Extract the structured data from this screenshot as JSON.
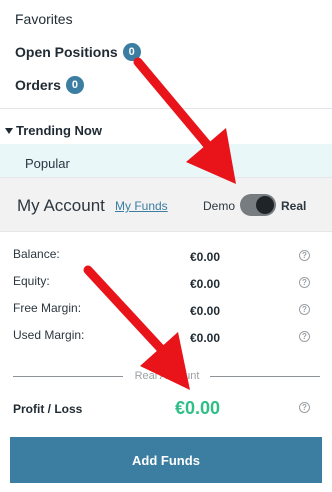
{
  "nav": {
    "items": [
      {
        "label": "Favorites",
        "badge": ""
      },
      {
        "label": "Open Positions",
        "badge": "0"
      },
      {
        "label": "Orders",
        "badge": "0"
      }
    ],
    "trending": "Trending Now",
    "popular": "Popular"
  },
  "account": {
    "title": "My Account",
    "my_funds": "My Funds",
    "demo_label": "Demo",
    "real_label": "Real",
    "mode": "Real"
  },
  "rows": [
    {
      "label": "Balance:",
      "value": "€0.00"
    },
    {
      "label": "Equity:",
      "value": "€0.00"
    },
    {
      "label": "Free Margin:",
      "value": "€0.00"
    },
    {
      "label": "Used Margin:",
      "value": "€0.00"
    }
  ],
  "separator_label": "Real Account",
  "profit_loss": {
    "label": "Profit / Loss",
    "value": "€0.00"
  },
  "add_funds_label": "Add Funds",
  "help_glyph": "?",
  "colors": {
    "accent": "#3b7ea1",
    "profit": "#2fbf86",
    "annotation_arrow": "#e8141a"
  }
}
